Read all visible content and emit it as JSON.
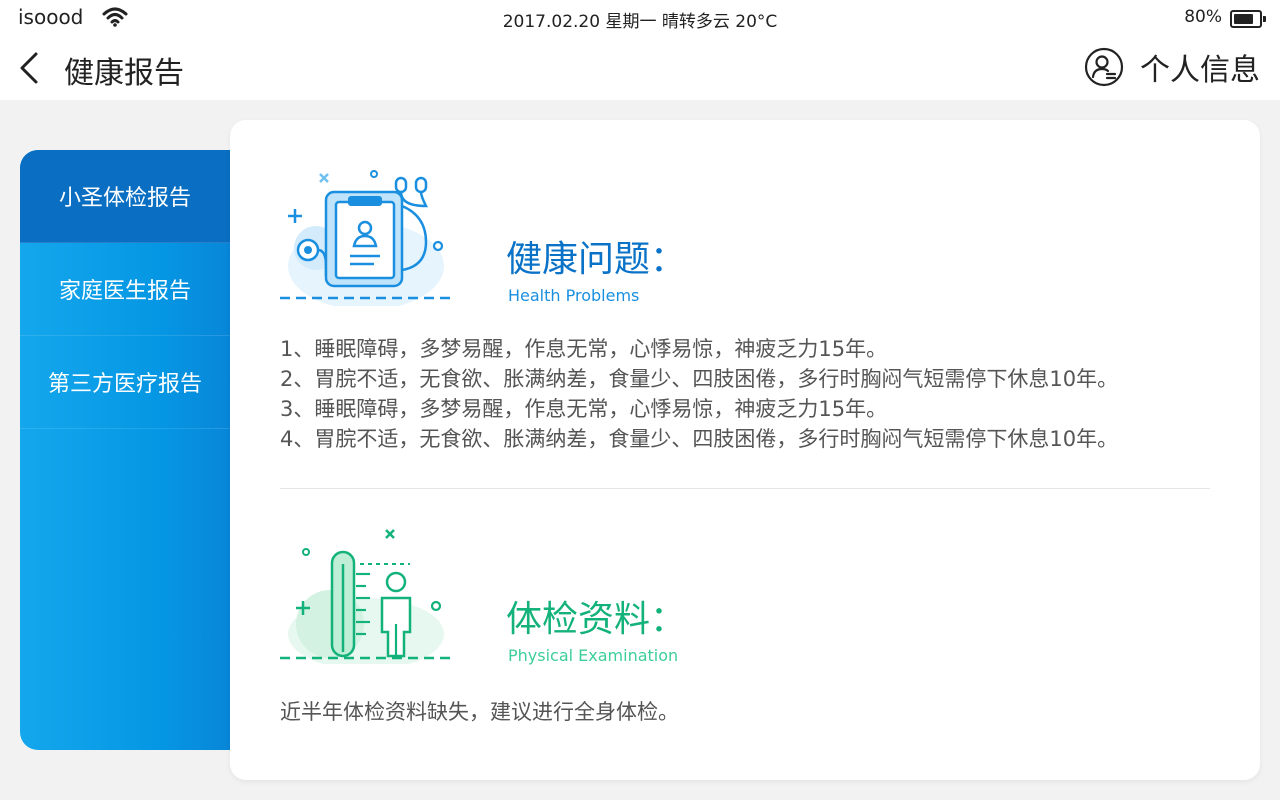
{
  "status_bar": {
    "carrier": "isoood",
    "center": "2017.02.20  星期一  晴转多云  20°C",
    "battery_pct": "80%",
    "battery_level": 0.8
  },
  "nav": {
    "title": "健康报告",
    "profile_label": "个人信息"
  },
  "sidebar": {
    "items": [
      {
        "label": "小圣体检报告",
        "active": true
      },
      {
        "label": "家庭医生报告",
        "active": false
      },
      {
        "label": "第三方医疗报告",
        "active": false
      }
    ]
  },
  "health_problems": {
    "title": "健康问题：",
    "subtitle": "Health Problems",
    "items": [
      "1、睡眠障碍，多梦易醒，作息无常，心悸易惊，神疲乏力15年。",
      "2、胃脘不适，无食欲、胀满纳差，食量少、四肢困倦，多行时胸闷气短需停下休息10年。",
      "3、睡眠障碍，多梦易醒，作息无常，心悸易惊，神疲乏力15年。",
      "4、胃脘不适，无食欲、胀满纳差，食量少、四肢困倦，多行时胸闷气短需停下休息10年。"
    ]
  },
  "physical_exam": {
    "title": "体检资料：",
    "subtitle": "Physical Examination",
    "text": "近半年体检资料缺失，建议进行全身体检。"
  },
  "colors": {
    "blue_accent": "#0a73c8",
    "blue_sub": "#1a8fe0",
    "green_accent": "#13b27a",
    "green_sub": "#3ccf9a",
    "sidebar_blue": "#0596e3",
    "sidebar_active": "#0a6fc2"
  },
  "icons": {
    "wifi": "wifi-icon",
    "back": "chevron-left-icon",
    "profile": "user-circle-icon",
    "clipboard": "medical-clipboard-icon",
    "measure": "height-measure-icon"
  }
}
